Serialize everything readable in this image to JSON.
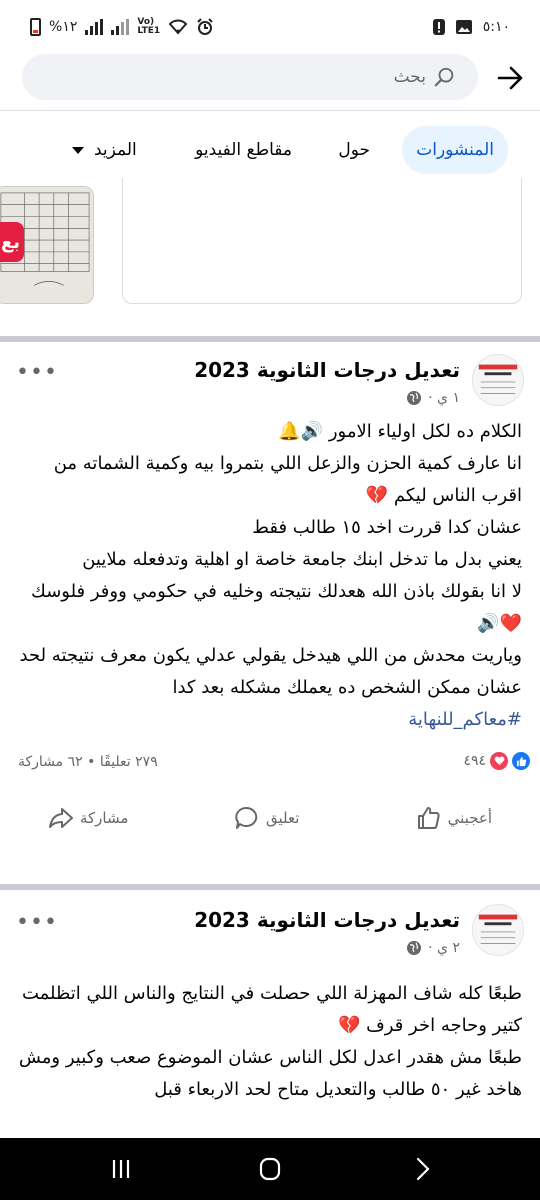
{
  "status_bar": {
    "time": "٥:١٠",
    "battery_percent": "%١٢",
    "network_label_top": "Vo)",
    "network_label_bottom": "LTE1"
  },
  "search": {
    "placeholder": "بحث"
  },
  "tabs": [
    {
      "label": "المنشورات",
      "active": true
    },
    {
      "label": "حول",
      "active": false
    },
    {
      "label": "مقاطع الفيديو",
      "active": false
    },
    {
      "label": "المزيد",
      "active": false
    }
  ],
  "strip": {
    "red_badge_text": "بع"
  },
  "posts": [
    {
      "page_name": "تعديل درجات الثانوية 2023",
      "time": "١ ي ·",
      "lines": [
        "الكلام ده لكل اولياء الامور 🔊🔔",
        "انا عارف كمية الحزن والزعل اللي بتمروا بيه وكمية الشماته من اقرب الناس ليكم 💔",
        "عشان كدا قررت اخد ١٥ طالب فقط",
        "يعني بدل ما تدخل ابنك جامعة خاصة او اهلية وتدفعله ملايين",
        "لا انا بقولك باذن الله هعدلك نتيجته وخليه في حكومي ووفر فلوسك ❤️🔊",
        "وياريت محدش من اللي هيدخل يقولي عدلي يكون معرف نتيجته لحد عشان ممكن الشخص ده يعملك مشكله بعد كدا"
      ],
      "hashtag": "#معاكم_للنهاية",
      "reactions_count": "٤٩٤",
      "comments_shares": "٢٧٩ تعليقًا • ٦٢ مشاركة",
      "actions": {
        "like": "أعجبني",
        "comment": "تعليق",
        "share": "مشاركة"
      }
    },
    {
      "page_name": "تعديل درجات الثانوية 2023",
      "time": "٢ ي ·",
      "lines": [
        "طبعًا كله شاف المهزلة اللي حصلت في النتايج والناس اللي اتظلمت كتير وحاجه اخر قرف 💔",
        "طبعًا مش هقدر اعدل لكل الناس عشان الموضوع صعب وكبير ومش هاخد غير ٥٠ طالب والتعديل متاح لحد الاربعاء قبل"
      ]
    }
  ],
  "colors": {
    "accent_blue": "#0a58ca",
    "tab_active_bg": "#e7f3ff",
    "hashtag": "#385898",
    "like_blue": "#1877f2",
    "love_red": "#f33e58"
  }
}
